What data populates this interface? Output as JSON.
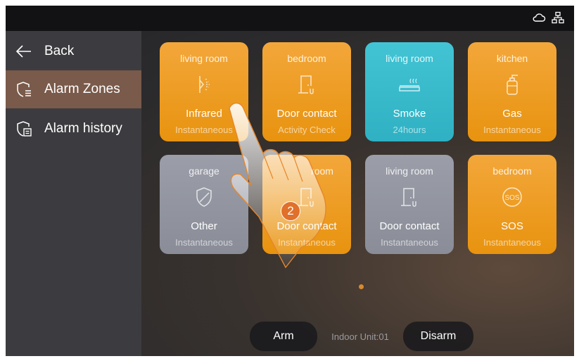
{
  "sidebar": {
    "items": [
      {
        "label": "Back",
        "icon": "arrow-left-icon"
      },
      {
        "label": "Alarm Zones",
        "icon": "shield-list-icon",
        "selected": true
      },
      {
        "label": "Alarm history",
        "icon": "shield-history-icon"
      }
    ]
  },
  "topbar": {
    "icons": [
      "cloud-icon",
      "network-icon"
    ]
  },
  "zones": [
    {
      "room": "living room",
      "type": "Infrared",
      "mode": "Instantaneous",
      "color": "#f0a22e",
      "icon": "infrared-sensor-icon"
    },
    {
      "room": "bedroom",
      "type": "Door contact",
      "mode": "Activity Check",
      "color": "#f0a22e",
      "icon": "door-contact-icon"
    },
    {
      "room": "living room",
      "type": "Smoke",
      "mode": "24hours",
      "color": "#3bbdce",
      "icon": "smoke-detector-icon"
    },
    {
      "room": "kitchen",
      "type": "Gas",
      "mode": "Instantaneous",
      "color": "#f0a22e",
      "icon": "gas-cylinder-icon"
    },
    {
      "room": "garage",
      "type": "Other",
      "mode": "Instantaneous",
      "color": "#9598a4",
      "icon": "shield-slash-icon"
    },
    {
      "room": "room",
      "type": "Door contact",
      "mode": "Instantaneous",
      "color": "#f0a22e",
      "icon": "door-contact-icon"
    },
    {
      "room": "living room",
      "type": "Door contact",
      "mode": "Instantaneous",
      "color": "#9598a4",
      "icon": "door-contact-icon"
    },
    {
      "room": "bedroom",
      "type": "SOS",
      "mode": "Instantaneous",
      "color": "#f0a22e",
      "icon": "sos-icon"
    }
  ],
  "pagination": {
    "active_page": 1,
    "total_pages": 1
  },
  "bottom": {
    "arm_label": "Arm",
    "unit_label": "Indoor Unit:01",
    "disarm_label": "Disarm"
  },
  "overlay": {
    "step_number": "2"
  }
}
